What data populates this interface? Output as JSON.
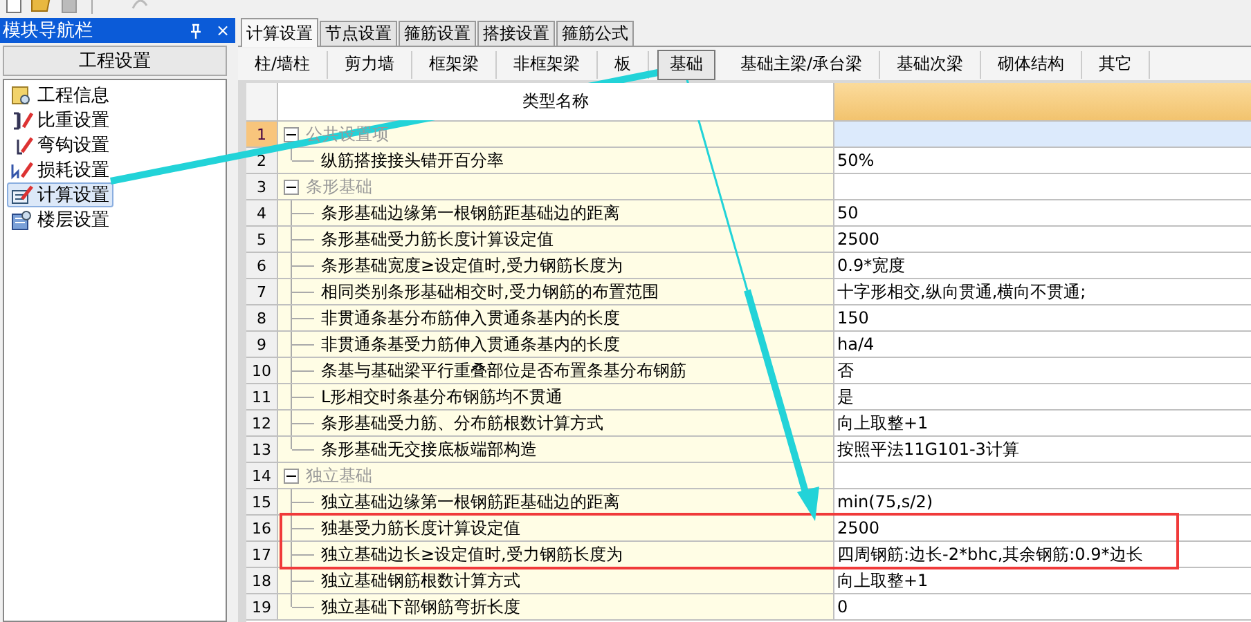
{
  "nav_panel": {
    "title": "模块导航栏",
    "close": "×",
    "section": "工程设置",
    "items": [
      {
        "label": "工程信息",
        "selected": false
      },
      {
        "label": "比重设置",
        "selected": false
      },
      {
        "label": "弯钩设置",
        "selected": false
      },
      {
        "label": "损耗设置",
        "selected": false
      },
      {
        "label": "计算设置",
        "selected": true
      },
      {
        "label": "楼层设置",
        "selected": false
      }
    ]
  },
  "tabs": [
    {
      "label": "计算设置",
      "selected": true
    },
    {
      "label": "节点设置",
      "selected": false
    },
    {
      "label": "箍筋设置",
      "selected": false
    },
    {
      "label": "搭接设置",
      "selected": false
    },
    {
      "label": "箍筋公式",
      "selected": false
    }
  ],
  "subtabs": [
    {
      "label": "柱/墙柱",
      "selected": false
    },
    {
      "label": "剪力墙",
      "selected": false
    },
    {
      "label": "框架梁",
      "selected": false
    },
    {
      "label": "非框架梁",
      "selected": false
    },
    {
      "label": "板",
      "selected": false
    },
    {
      "label": "基础",
      "selected": true
    },
    {
      "label": "基础主梁/承台梁",
      "selected": false
    },
    {
      "label": "基础次梁",
      "selected": false
    },
    {
      "label": "砌体结构",
      "selected": false
    },
    {
      "label": "其它",
      "selected": false
    }
  ],
  "table": {
    "columns": [
      "类型名称"
    ],
    "rows": [
      {
        "number": "1",
        "name": "公共设置项",
        "expanded": true,
        "selected": true,
        "highlighted": false,
        "children": [
          {
            "number": "2",
            "name": "纵筋搭接接头错开百分率",
            "value": "50%",
            "selected": false,
            "highlighted": false
          }
        ]
      },
      {
        "number": "3",
        "name": "条形基础",
        "expanded": true,
        "selected": false,
        "highlighted": false,
        "children": [
          {
            "number": "4",
            "name": "条形基础边缘第一根钢筋距基础边的距离",
            "value": "50",
            "selected": false,
            "highlighted": false
          },
          {
            "number": "5",
            "name": "条形基础受力筋长度计算设定值",
            "value": "2500",
            "selected": false,
            "highlighted": false
          },
          {
            "number": "6",
            "name": "条形基础宽度≥设定值时,受力钢筋长度为",
            "value": "0.9*宽度",
            "selected": false,
            "highlighted": false
          },
          {
            "number": "7",
            "name": "相同类别条形基础相交时,受力钢筋的布置范围",
            "value": "十字形相交,纵向贯通,横向不贯通;",
            "selected": false,
            "highlighted": false
          },
          {
            "number": "8",
            "name": "非贯通条基分布筋伸入贯通条基内的长度",
            "value": "150",
            "selected": false,
            "highlighted": false
          },
          {
            "number": "9",
            "name": "非贯通条基受力筋伸入贯通条基内的长度",
            "value": "ha/4",
            "selected": false,
            "highlighted": false
          },
          {
            "number": "10",
            "name": "条基与基础梁平行重叠部位是否布置条基分布钢筋",
            "value": "否",
            "selected": false,
            "highlighted": false
          },
          {
            "number": "11",
            "name": "L形相交时条基分布钢筋均不贯通",
            "value": "是",
            "selected": false,
            "highlighted": false
          },
          {
            "number": "12",
            "name": "条形基础受力筋、分布筋根数计算方式",
            "value": "向上取整+1",
            "selected": false,
            "highlighted": false
          },
          {
            "number": "13",
            "name": "条形基础无交接底板端部构造",
            "value": "按照平法11G101-3计算",
            "selected": false,
            "highlighted": false
          }
        ]
      },
      {
        "number": "14",
        "name": "独立基础",
        "expanded": true,
        "selected": false,
        "highlighted": false,
        "children": [
          {
            "number": "15",
            "name": "独立基础边缘第一根钢筋距基础边的距离",
            "value": "min(75,s/2)",
            "selected": false,
            "highlighted": false
          },
          {
            "number": "16",
            "name": "独基受力筋长度计算设定值",
            "value": "2500",
            "selected": false,
            "highlighted": true
          },
          {
            "number": "17",
            "name": "独立基础边长≥设定值时,受力钢筋长度为",
            "value": "四周钢筋:边长-2*bhc,其余钢筋:0.9*边长",
            "selected": false,
            "highlighted": true
          },
          {
            "number": "18",
            "name": "独立基础钢筋根数计算方式",
            "value": "向上取整+1",
            "selected": false,
            "highlighted": false
          },
          {
            "number": "19",
            "name": "独立基础下部钢筋弯折长度",
            "value": "0",
            "selected": false,
            "highlighted": false
          }
        ]
      }
    ]
  }
}
